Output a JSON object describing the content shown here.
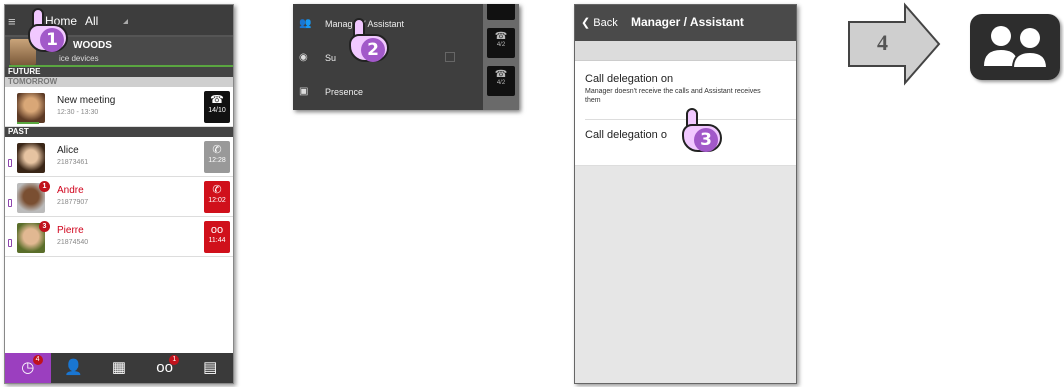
{
  "panel1": {
    "menu_glyph": "≡",
    "tab_home": "Home",
    "tab_all": "All",
    "user_name": "WOODS",
    "user_sub": "ice devices",
    "sections": {
      "future": "FUTURE",
      "tomorrow": "TOMORROW",
      "past": "PAST"
    },
    "meeting": {
      "title": "New meeting",
      "time": "12:30 - 13:30",
      "tile_icon": "phone-grid-icon",
      "tile_text": "14/10"
    },
    "calls": [
      {
        "name": "Alice",
        "number": "21873461",
        "time": "12:28",
        "badge": "",
        "missed": false,
        "tile_color": "#999999",
        "icon": "phone-incoming-icon"
      },
      {
        "name": "Andre",
        "number": "21877907",
        "time": "12:02",
        "badge": "1",
        "missed": true,
        "tile_color": "#d0101b",
        "icon": "phone-missed-icon"
      },
      {
        "name": "Pierre",
        "number": "21874540",
        "time": "11:44",
        "badge": "3",
        "missed": true,
        "tile_color": "#d0101b",
        "icon": "voicemail-icon"
      }
    ],
    "bottom_tabs": [
      {
        "icon": "history-icon",
        "badge": "4",
        "active": true
      },
      {
        "icon": "contacts-icon",
        "badge": "",
        "active": false
      },
      {
        "icon": "dialpad-icon",
        "badge": "",
        "active": false
      },
      {
        "icon": "voicemail-icon",
        "badge": "1",
        "active": false
      },
      {
        "icon": "calendar-icon",
        "badge": "",
        "active": false
      }
    ]
  },
  "panel2": {
    "items": [
      {
        "icon": "manager-assistant-icon",
        "label": "Manager / Assistant"
      },
      {
        "icon": "eye-icon",
        "label": "Su"
      },
      {
        "icon": "presence-icon",
        "label": "Presence"
      }
    ],
    "tile_text": "4/2"
  },
  "panel3": {
    "back_label": "Back",
    "title": "Manager / Assistant",
    "option1_title": "Call delegation on",
    "option1_desc": "Manager doesn't receive the calls and Assistant receives them",
    "option2_title": "Call delegation o"
  },
  "steps": [
    "1",
    "2",
    "3",
    "4"
  ],
  "colors": {
    "accent": "#9b3fbf",
    "missed": "#d0101b",
    "dark": "#3d3d3d"
  }
}
